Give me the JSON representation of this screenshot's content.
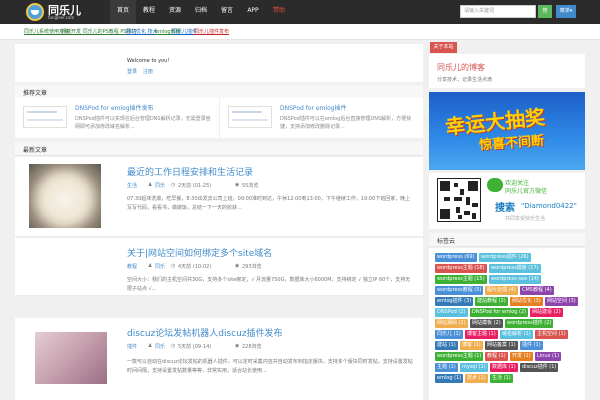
{
  "site": {
    "logo_text": "同乐儿",
    "logo_sub": "tongleer.com",
    "nav": [
      "首页",
      "教程",
      "资源",
      "归档",
      "留言",
      "APP",
      "赞助"
    ],
    "search_placeholder": "请输入关键词",
    "search_button": "搜",
    "menu_button": "菜单▾"
  },
  "tag_links": [
    {
      "label": "同乐儿系统使用攻略",
      "color": "#2e7d32"
    },
    {
      "label": "后端开发 同乐儿的PS教程 PS技巧",
      "color": "#2e7d32"
    },
    {
      "label": "网站优化 技术",
      "color": "#1565c0"
    },
    {
      "label": "emlog教程",
      "color": "#2e7d32"
    },
    {
      "label": "同乐儿插件",
      "color": "#1565c0"
    },
    {
      "label": "同乐儿插件发布",
      "color": "#c62828"
    }
  ],
  "welcome": {
    "text": "Welcome to you!",
    "links": [
      "登录",
      "注册"
    ]
  },
  "sections": {
    "recommend": "推荐文章",
    "latest": "最新文章"
  },
  "recommended": [
    {
      "title": "DNSPod for emlog插件发布",
      "desc": "DNSPod插件可以实现在后台管理DNS解析记录，无需登录官网即可添加修改域名解析..."
    },
    {
      "title": "DNSPod for emlog插件",
      "desc": "DNSPod插件可以在emlog后台直接管理DNS解析，方便快捷，支持添加修改删除记录..."
    }
  ],
  "posts": [
    {
      "title": "最近的工作日程安排和生活记录",
      "category": "生活",
      "author": "同乐",
      "date": "2天前 (01-25)",
      "views": "55浏览",
      "excerpt": "07:30起床洗漱，吃早餐，8:30出发去公司上班，09:00准时到达，午休12:00到13:00，下午继续工作，19:00下班回家，晚上写写代码，看看书，做做饭，总结一下一天的收获..."
    },
    {
      "title": "关于|网站空间如何绑定多个site域名",
      "category": "教程",
      "author": "同乐",
      "date": "4天前 (10-02)",
      "views": "293浏览",
      "excerpt": "空间大小：我们的主机空间共30G，支持多个site绑定，√ 月流量750G，数据库大小6000M，支持绑定 √ 独立IP 60个，支持无限子站点 √..."
    },
    {
      "title": "discuz论坛发帖机器人discuz插件发布",
      "category": "插件",
      "author": "同乐",
      "date": "5天前 (09-14)",
      "views": "228浏览",
      "excerpt": "一款可以自动在discuz论坛发帖的机器人插件，可以定时采集内容并自动发布到指定版块，支持多个版块同时发帖，支持设置发帖时间间隔，支持设置发帖数量等等，非常实用，适合站长使用..."
    }
  ],
  "sidebar": {
    "box_title": "关于本站",
    "text_title": "同乐儿的博客",
    "text_sub": "分享技术，记录生活点滴",
    "banner_main": "幸运大抽奖",
    "banner_sub": "惊喜不间断",
    "wechat_line1": "欢迎关注",
    "wechat_line2": "同乐儿官方微信",
    "wechat_search": "搜索",
    "wechat_id": "\"Diamond0422\"",
    "wechat_slogan": "共同享受快乐生活",
    "tags_title": "标签云"
  },
  "tags": [
    {
      "label": "wordpress (69)",
      "color": "#4a90d9"
    },
    {
      "label": "wordpress插件 (26)",
      "color": "#5bc0de"
    },
    {
      "label": "wordpress主题 (18)",
      "color": "#d9534f"
    },
    {
      "label": "wordpress模板 (17)",
      "color": "#5bc0de"
    },
    {
      "label": "wordpress主题 (15)",
      "color": "#3eb135"
    },
    {
      "label": "wordpress seo (14)",
      "color": "#5bc0de"
    },
    {
      "label": "wordpress教程 (5)",
      "color": "#4a90d9"
    },
    {
      "label": "图片处理 (4)",
      "color": "#f0ad4e"
    },
    {
      "label": "CMS教程 (4)",
      "color": "#8e44ad"
    },
    {
      "label": "emlog插件 (3)",
      "color": "#337ab7"
    },
    {
      "label": "建站教程 (3)",
      "color": "#3eb135"
    },
    {
      "label": "网站优化 (3)",
      "color": "#e67e22"
    },
    {
      "label": "网站空间 (3)",
      "color": "#8e44ad"
    },
    {
      "label": "DNSPod (2)",
      "color": "#5bc0de"
    },
    {
      "label": "DNSPod for emlog (2)",
      "color": "#3eb135"
    },
    {
      "label": "网站建设 (2)",
      "color": "#e91e63"
    },
    {
      "label": "网站源码 (2)",
      "color": "#f0ad4e"
    },
    {
      "label": "网站模板 (2)",
      "color": "#555555"
    },
    {
      "label": "wordpress插件 (2)",
      "color": "#3eb135"
    },
    {
      "label": "同乐儿 (1)",
      "color": "#4a90d9"
    },
    {
      "label": "博客主题 (1)",
      "color": "#e91e63"
    },
    {
      "label": "域名解析 (1)",
      "color": "#5bc0de"
    },
    {
      "label": "主机空间 (1)",
      "color": "#d9534f"
    },
    {
      "label": "建站 (1)",
      "color": "#337ab7"
    },
    {
      "label": "博客 (1)",
      "color": "#f0ad4e"
    },
    {
      "label": "网站备案 (1)",
      "color": "#555555"
    },
    {
      "label": "插件 (1)",
      "color": "#4a90d9"
    },
    {
      "label": "wordpress主题 (1)",
      "color": "#3eb135"
    },
    {
      "label": "教程 (1)",
      "color": "#d9534f"
    },
    {
      "label": "开发 (1)",
      "color": "#e67e22"
    },
    {
      "label": "Linux (1)",
      "color": "#8e44ad"
    },
    {
      "label": "主题 (1)",
      "color": "#4a90d9"
    },
    {
      "label": "mysql (1)",
      "color": "#5bc0de"
    },
    {
      "label": "数据库 (1)",
      "color": "#e91e63"
    },
    {
      "label": "discuz插件 (1)",
      "color": "#555555"
    },
    {
      "label": "emlog (1)",
      "color": "#337ab7"
    },
    {
      "label": "技术 (1)",
      "color": "#f0ad4e"
    },
    {
      "label": "生活 (1)",
      "color": "#3eb135"
    }
  ]
}
